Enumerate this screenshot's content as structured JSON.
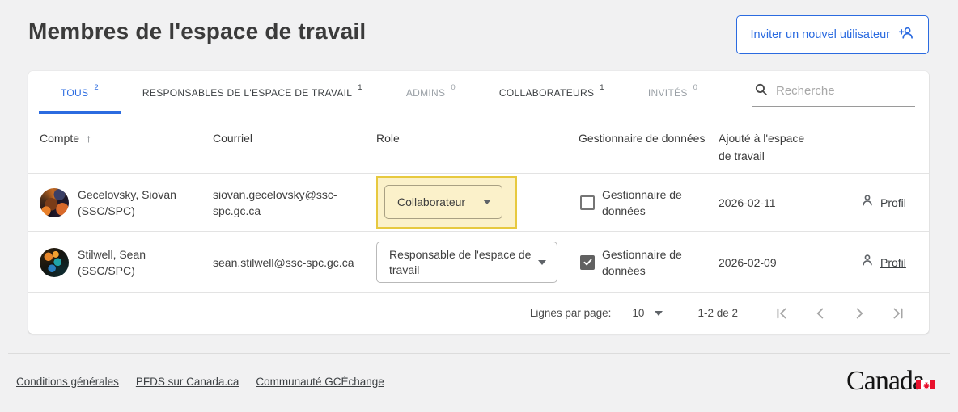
{
  "page": {
    "title": "Membres de l'espace de travail",
    "invite_button_label": "Inviter un nouvel utilisateur"
  },
  "tabs": [
    {
      "label": "TOUS",
      "count": "2",
      "state": "active"
    },
    {
      "label": "RESPONSABLES DE L'ESPACE DE TRAVAIL",
      "count": "1",
      "state": "normal"
    },
    {
      "label": "ADMINS",
      "count": "0",
      "state": "disabled"
    },
    {
      "label": "COLLABORATEURS",
      "count": "1",
      "state": "normal"
    },
    {
      "label": "INVITÉS",
      "count": "0",
      "state": "disabled"
    }
  ],
  "search": {
    "placeholder": "Recherche"
  },
  "table": {
    "headers": {
      "account": "Compte",
      "email": "Courriel",
      "role": "Role",
      "data_steward": "Gestionnaire de données",
      "added": "Ajouté à l'espace de travail"
    },
    "rows": [
      {
        "name": "Gecelovsky, Siovan",
        "org": "(SSC/SPC)",
        "email": "siovan.gecelovsky@ssc-spc.gc.ca",
        "role": "Collaborateur",
        "data_steward_label": "Gestionnaire de données",
        "data_steward_checked": false,
        "added": "2026-02-11",
        "profile_label": "Profil",
        "role_highlighted": true
      },
      {
        "name": "Stilwell, Sean",
        "org": "(SSC/SPC)",
        "email": "sean.stilwell@ssc-spc.gc.ca",
        "role": "Responsable de l'espace de travail",
        "data_steward_label": "Gestionnaire de données",
        "data_steward_checked": true,
        "added": "2026-02-09",
        "profile_label": "Profil",
        "role_highlighted": false
      }
    ]
  },
  "pagination": {
    "rows_per_page_label": "Lignes par page:",
    "rows_per_page_value": "10",
    "range": "1-2 de 2"
  },
  "footer": {
    "links": [
      {
        "label": "Conditions générales"
      },
      {
        "label": "PFDS sur Canada.ca"
      },
      {
        "label": "Communauté GCÉchange"
      }
    ],
    "wordmark": "Canada"
  },
  "colors": {
    "accent_blue": "#2b6be0",
    "highlight_bg": "#fbf1ca",
    "highlight_border": "#e7c93f",
    "flag_red": "#e8112d"
  }
}
